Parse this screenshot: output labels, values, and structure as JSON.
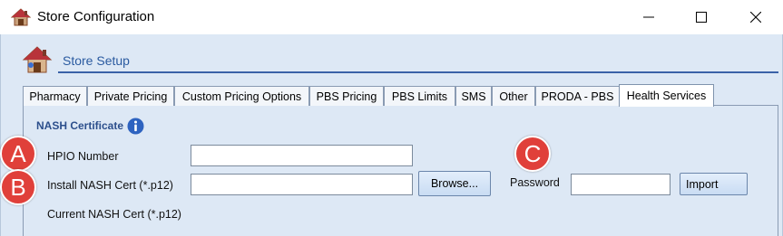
{
  "window": {
    "title": "Store Configuration",
    "controls": [
      "minimize-icon",
      "maximize-icon",
      "close-icon"
    ]
  },
  "header": {
    "title": "Store Setup",
    "icon": "house-icon"
  },
  "tabs": [
    {
      "label": "Pharmacy",
      "active": false
    },
    {
      "label": "Private Pricing",
      "active": false
    },
    {
      "label": "Custom Pricing Options",
      "active": false
    },
    {
      "label": "PBS Pricing",
      "active": false
    },
    {
      "label": "PBS Limits",
      "active": false
    },
    {
      "label": "SMS",
      "active": false
    },
    {
      "label": "Other",
      "active": false
    },
    {
      "label": "PRODA - PBS",
      "active": false
    },
    {
      "label": "Health Services",
      "active": true
    }
  ],
  "nash": {
    "section_title": "NASH Certificate",
    "info_icon": "info-icon",
    "hpio_label": "HPIO Number",
    "hpio_value": "",
    "install_label": "Install NASH Cert (*.p12)",
    "install_value": "",
    "browse_label": "Browse...",
    "password_label": "Password",
    "password_value": "",
    "import_label": "Import",
    "current_label": "Current NASH Cert (*.p12)"
  },
  "markers": [
    "A",
    "B",
    "C"
  ],
  "colors": {
    "accent": "#2a5aa0",
    "panel_bg": "#dde8f5",
    "marker": "#e0403a"
  }
}
